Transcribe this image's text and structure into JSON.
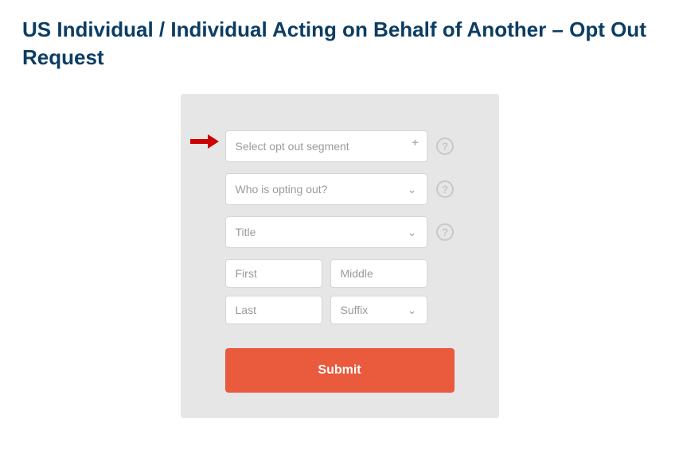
{
  "title": "US Individual / Individual Acting on Behalf of Another – Opt Out Request",
  "form": {
    "segment_placeholder": "Select opt out segment",
    "who_placeholder": "Who is opting out?",
    "title_placeholder": "Title",
    "first_placeholder": "First",
    "middle_placeholder": "Middle",
    "last_placeholder": "Last",
    "suffix_placeholder": "Suffix",
    "submit_label": "Submit"
  },
  "colors": {
    "title": "#0c3d63",
    "card_bg": "#e6e6e6",
    "submit_bg": "#ea5a3c",
    "arrow": "#cc0000"
  }
}
